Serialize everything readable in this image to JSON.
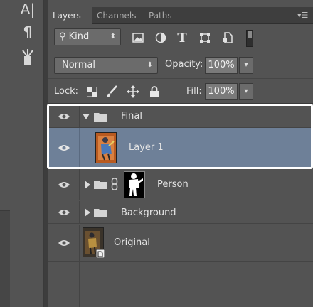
{
  "toolstrip": {
    "tools": [
      {
        "name": "type-mask-tool-icon",
        "glyph": "A|"
      },
      {
        "name": "paragraph-icon",
        "glyph": "¶"
      },
      {
        "name": "tools-icon",
        "glyph": "⚒"
      }
    ]
  },
  "panel": {
    "tabs": [
      {
        "label": "Layers",
        "active": true
      },
      {
        "label": "Channels",
        "active": false
      },
      {
        "label": "Paths",
        "active": false
      }
    ]
  },
  "filter": {
    "kind_label": "Kind",
    "icons": [
      "pixel-filter-icon",
      "adjustment-filter-icon",
      "type-filter-icon",
      "shape-filter-icon",
      "smart-object-filter-icon"
    ]
  },
  "blend": {
    "mode": "Normal",
    "opacity_label": "Opacity:",
    "opacity_value": "100%"
  },
  "lock": {
    "label": "Lock:",
    "fill_label": "Fill:",
    "fill_value": "100%"
  },
  "layers": [
    {
      "name": "Final",
      "type": "group",
      "expanded": true
    },
    {
      "name": "Layer 1",
      "type": "pixel",
      "selected": true
    },
    {
      "name": "Person",
      "type": "group",
      "expanded": false,
      "has_mask": true
    },
    {
      "name": "Background",
      "type": "group",
      "expanded": false
    },
    {
      "name": "Original",
      "type": "smart-object"
    }
  ],
  "colors": {
    "panel_bg": "#535353",
    "selected_row": "#6e8098",
    "highlight": "#ffffff"
  }
}
